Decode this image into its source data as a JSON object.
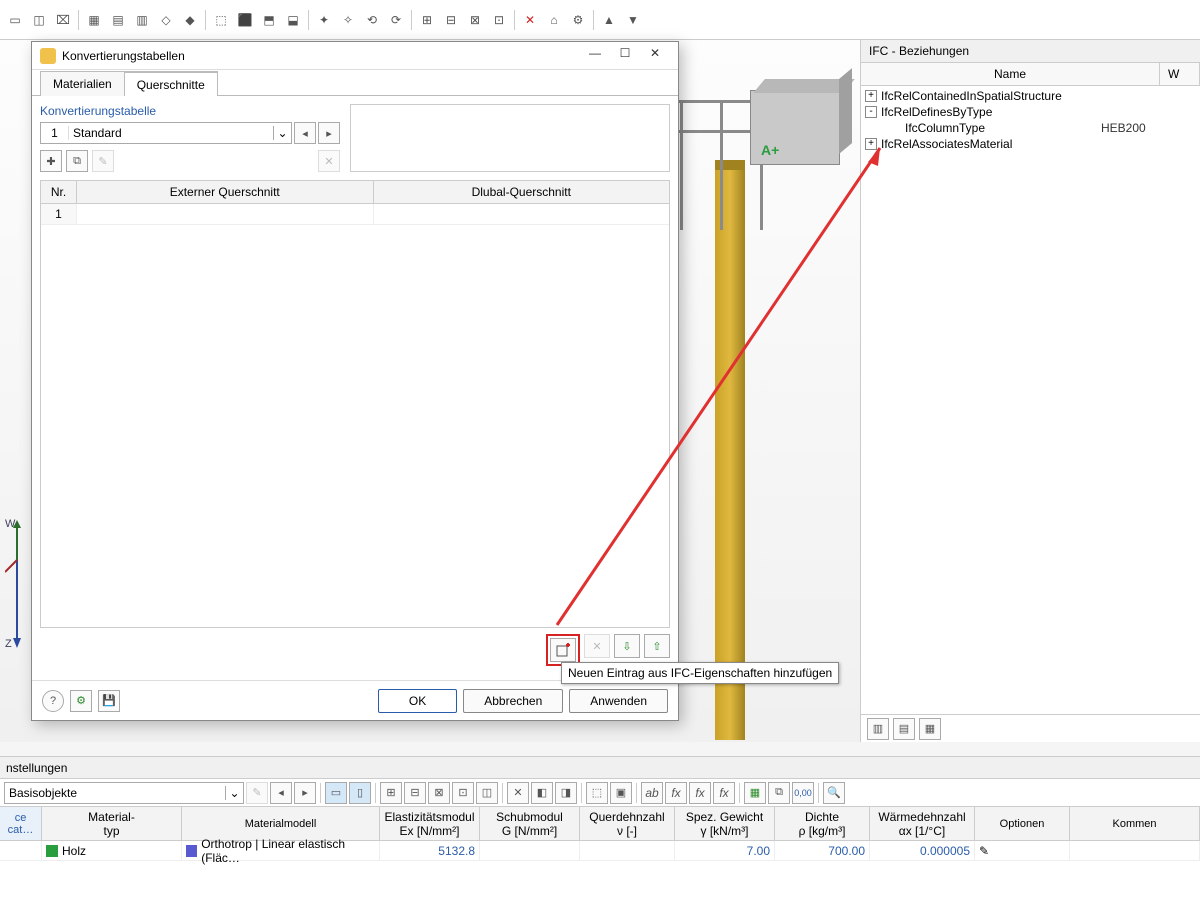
{
  "dialog": {
    "title": "Konvertierungstabellen",
    "tabs": {
      "materialien": "Materialien",
      "querschnitte": "Querschnitte"
    },
    "section_label": "Konvertierungstabelle",
    "combo": {
      "num": "1",
      "text": "Standard"
    },
    "grid": {
      "headers": {
        "nr": "Nr.",
        "ext": "Externer Querschnitt",
        "dlb": "Dlubal-Querschnitt"
      },
      "rows": [
        {
          "nr": "1",
          "ext": "",
          "dlb": ""
        }
      ]
    },
    "tooltip": "Neuen Eintrag aus IFC-Eigenschaften hinzufügen",
    "buttons": {
      "ok": "OK",
      "cancel": "Abbrechen",
      "apply": "Anwenden"
    }
  },
  "ifc": {
    "title": "IFC - Beziehungen",
    "head": {
      "name": "Name",
      "w": "W"
    },
    "tree": [
      {
        "indent": 0,
        "toggle": "+",
        "label": "IfcRelContainedInSpatialStructure",
        "value": ""
      },
      {
        "indent": 0,
        "toggle": "-",
        "label": "IfcRelDefinesByType",
        "value": ""
      },
      {
        "indent": 1,
        "toggle": "",
        "label": "IfcColumnType",
        "value": "HEB200"
      },
      {
        "indent": 0,
        "toggle": "+",
        "label": "IfcRelAssociatesMaterial",
        "value": ""
      }
    ]
  },
  "lower": {
    "title": "nstellungen",
    "combo": "Basisobjekte",
    "head": {
      "cat": "ce cat…",
      "typ": {
        "l1": "Material-",
        "l2": "typ"
      },
      "model": "Materialmodell",
      "e": {
        "l1": "Elastizitätsmodul",
        "l2": "Ex [N/mm²]"
      },
      "g": {
        "l1": "Schubmodul",
        "l2": "G [N/mm²]"
      },
      "v": {
        "l1": "Querdehnzahl",
        "l2": "ν [-]"
      },
      "spez": {
        "l1": "Spez. Gewicht",
        "l2": "γ [kN/m³]"
      },
      "dichte": {
        "l1": "Dichte",
        "l2": "ρ [kg/m³]"
      },
      "warm": {
        "l1": "Wärmedehnzahl",
        "l2": "αx [1/°C]"
      },
      "opt": "Optionen",
      "kom": "Kommen"
    },
    "row": {
      "typ_color": "#2a9d3f",
      "typ": "Holz",
      "model_color": "#5a5ad0",
      "model": "Orthotrop | Linear elastisch (Fläc…",
      "e": "5132.8",
      "g": "",
      "v": "",
      "spez": "7.00",
      "dichte": "700.00",
      "warm": "0.000005",
      "opt": "✎"
    }
  },
  "axis": {
    "w": "W",
    "z": "Z"
  },
  "box_label": "A+"
}
